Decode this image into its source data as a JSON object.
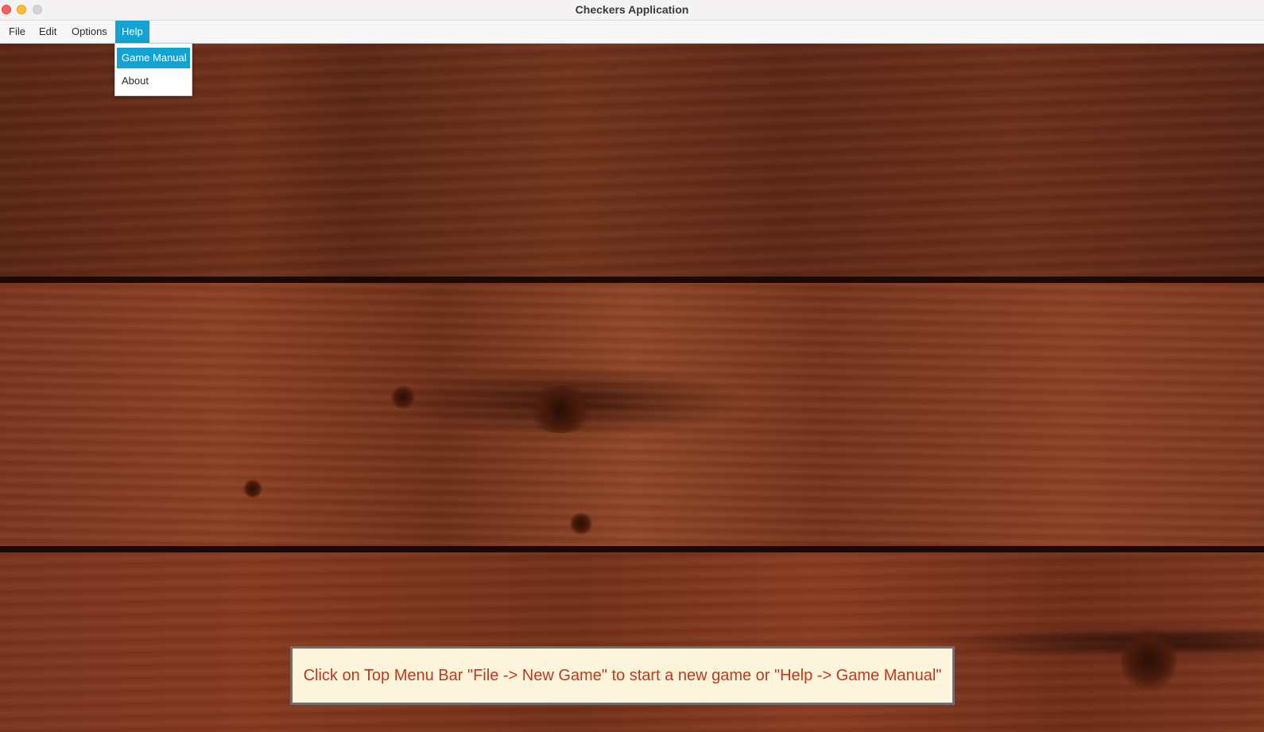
{
  "window": {
    "title": "Checkers Application"
  },
  "menubar": {
    "items": [
      {
        "label": "File"
      },
      {
        "label": "Edit"
      },
      {
        "label": "Options"
      },
      {
        "label": "Help"
      }
    ],
    "active": "Help"
  },
  "help_menu": {
    "items": [
      {
        "label": "Game Manual",
        "highlighted": true
      },
      {
        "label": "About",
        "highlighted": false
      }
    ]
  },
  "message": {
    "text": "Click on Top Menu Bar \"File -> New Game\" to start a new game or \"Help -> Game Manual\""
  },
  "colors": {
    "accent": "#10a3d4",
    "message_text": "#c0381b",
    "message_background": "#fdf4dc"
  }
}
